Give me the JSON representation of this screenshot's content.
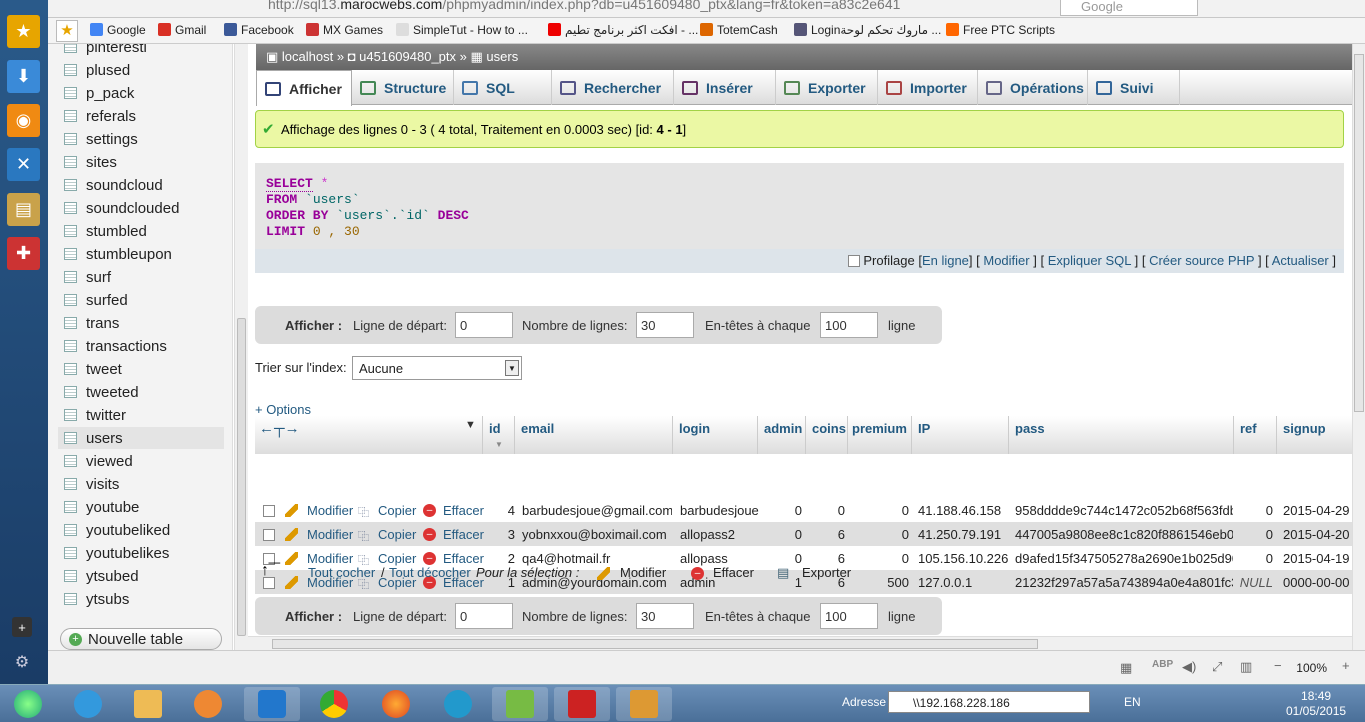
{
  "browser": {
    "url_prefix": "http://sql13.",
    "url_host": "marocwebs.com",
    "url_rest": "/phpmyadmin/index.php?db=u451609480_ptx&lang=fr&token=a83c2e641",
    "search_placeholder": "Google"
  },
  "bookmarks": [
    {
      "label": "Google",
      "icon": "google-icon",
      "color": "#4285f4"
    },
    {
      "label": "Gmail",
      "icon": "gmail-icon",
      "color": "#d93025"
    },
    {
      "label": "Facebook",
      "icon": "facebook-icon",
      "color": "#3b5998"
    },
    {
      "label": "MX Games",
      "icon": "mx-games-icon",
      "color": "#c33"
    },
    {
      "label": "SimpleTut - How to ...",
      "icon": "page-icon",
      "color": "#ddd"
    },
    {
      "label": "افكت اكثر برنامج تطيم - ...",
      "icon": "youtube-icon",
      "color": "#e00"
    },
    {
      "label": "TotemCash",
      "icon": "totemcash-icon",
      "color": "#d60"
    },
    {
      "label": "Loginماروك تحكم لوحة ...",
      "icon": "globe-icon",
      "color": "#557"
    },
    {
      "label": "Free PTC Scripts",
      "icon": "blogger-icon",
      "color": "#f60"
    }
  ],
  "sidebar": {
    "tables": [
      "pinteresti",
      "plused",
      "p_pack",
      "referals",
      "settings",
      "sites",
      "soundcloud",
      "soundclouded",
      "stumbled",
      "stumbleupon",
      "surf",
      "surfed",
      "trans",
      "transactions",
      "tweet",
      "tweeted",
      "twitter",
      "users",
      "viewed",
      "visits",
      "youtube",
      "youtubeliked",
      "youtubelikes",
      "ytsubed",
      "ytsubs"
    ],
    "selected": "users",
    "new_table": "Nouvelle table"
  },
  "breadcrumb": {
    "server": "localhost",
    "db": "u451609480_ptx",
    "table": "users"
  },
  "tabs": [
    {
      "label": "Afficher",
      "icon": "browse-icon"
    },
    {
      "label": "Structure",
      "icon": "structure-icon"
    },
    {
      "label": "SQL",
      "icon": "sql-icon"
    },
    {
      "label": "Rechercher",
      "icon": "search-icon"
    },
    {
      "label": "Insérer",
      "icon": "insert-icon"
    },
    {
      "label": "Exporter",
      "icon": "export-icon"
    },
    {
      "label": "Importer",
      "icon": "import-icon"
    },
    {
      "label": "Opérations",
      "icon": "operations-icon"
    },
    {
      "label": "Suivi",
      "icon": "tracking-icon"
    }
  ],
  "message": {
    "text": "Affichage des lignes 0 - 3 ( 4 total, Traitement en 0.0003 sec) [id: ",
    "bold": "4 - 1",
    "end": "]"
  },
  "sql": {
    "l1_kw": "SELECT",
    "l1_rest": " *",
    "l2_kw": "FROM",
    "l2_rest": " `users`",
    "l3_kw": "ORDER BY",
    "l3_rest": " `users`.`id`",
    "l3_kw2": " DESC",
    "l4_kw": "LIMIT",
    "l4_rest": " 0 , 30",
    "profiling": "Profilage",
    "links": [
      "En ligne",
      "Modifier",
      "Expliquer SQL",
      "Créer source PHP",
      "Actualiser"
    ]
  },
  "navform": {
    "label": "Afficher :",
    "start_label": "Ligne de départ:",
    "start_value": "0",
    "rows_label": "Nombre de lignes:",
    "rows_value": "30",
    "headers_label": "En-têtes à chaque",
    "headers_value": "100",
    "unit": "ligne"
  },
  "sort": {
    "label": "Trier sur l'index:",
    "value": "Aucune"
  },
  "options_link": "+ Options",
  "columns": [
    "id",
    "email",
    "login",
    "admin",
    "coins",
    "premium",
    "IP",
    "pass",
    "ref",
    "signup"
  ],
  "row_actions": {
    "edit": "Modifier",
    "copy": "Copier",
    "delete": "Effacer"
  },
  "rows": [
    {
      "id": "4",
      "email": "barbudesjoue@gmail.com",
      "login": "barbudesjoue",
      "admin": "0",
      "coins": "0",
      "premium": "0",
      "ip": "41.188.46.158",
      "pass": "958dddde9c744c1472c052b68f563fdb",
      "ref": "0",
      "signup": "2015-04-29"
    },
    {
      "id": "3",
      "email": "yobnxxou@boximail.com",
      "login": "allopass2",
      "admin": "0",
      "coins": "6",
      "premium": "0",
      "ip": "41.250.79.191",
      "pass": "447005a9808ee8c1c820f8861546eb0d",
      "ref": "0",
      "signup": "2015-04-20"
    },
    {
      "id": "2",
      "email": "qa4@hotmail.fr",
      "login": "allopass",
      "admin": "0",
      "coins": "6",
      "premium": "0",
      "ip": "105.156.10.226",
      "pass": "d9afed15f347505278a2690e1b025d90",
      "ref": "0",
      "signup": "2015-04-19"
    },
    {
      "id": "1",
      "email": "admin@yourdomain.com",
      "login": "admin",
      "admin": "1",
      "coins": "6",
      "premium": "500",
      "ip": "127.0.0.1",
      "pass": "21232f297a57a5a743894a0e4a801fc3",
      "ref": "NULL",
      "signup": "0000-00-00"
    }
  ],
  "bulk": {
    "check_all": "Tout cocher",
    "sep": " / ",
    "uncheck_all": "Tout décocher",
    "for_selection": "Pour la sélection :",
    "edit": "Modifier",
    "delete": "Effacer",
    "export": "Exporter"
  },
  "status": {
    "zoom": "100%"
  },
  "taskbar": {
    "address_label": "Adresse",
    "address_value": "\\\\192.168.228.186",
    "lang": "EN",
    "time": "18:49",
    "date": "01/05/2015"
  }
}
